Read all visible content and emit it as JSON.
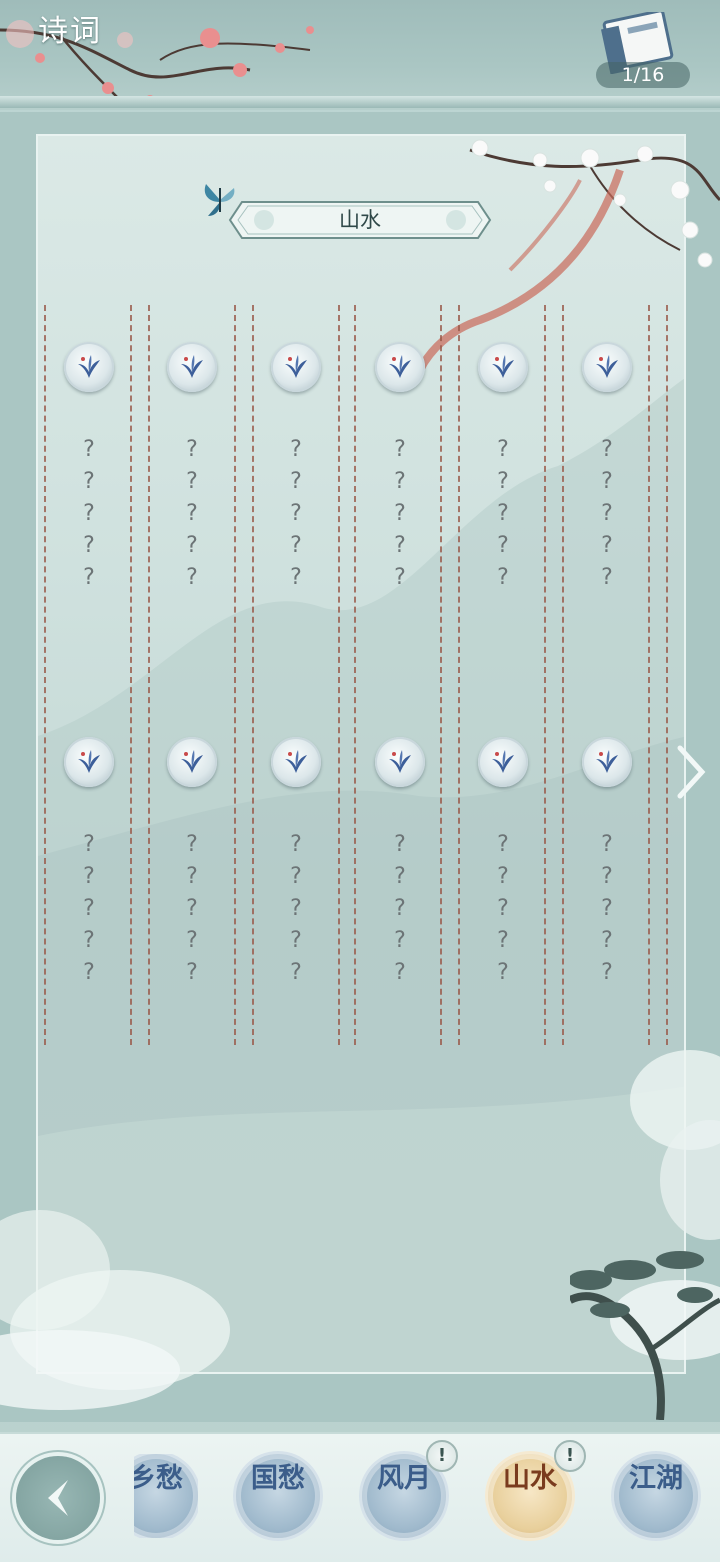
{
  "header": {
    "title": "诗词",
    "page_indicator": "1/16",
    "book_icon": "poetry-book-icon"
  },
  "section": {
    "banner_title": "山水"
  },
  "grid": {
    "rows": [
      {
        "cards": [
          {
            "icon": "orchid-medal-icon",
            "lines": [
              "?",
              "?",
              "?",
              "?",
              "?"
            ]
          },
          {
            "icon": "orchid-medal-icon",
            "lines": [
              "?",
              "?",
              "?",
              "?",
              "?"
            ]
          },
          {
            "icon": "orchid-medal-icon",
            "lines": [
              "?",
              "?",
              "?",
              "?",
              "?"
            ]
          },
          {
            "icon": "orchid-medal-icon",
            "lines": [
              "?",
              "?",
              "?",
              "?",
              "?"
            ]
          },
          {
            "icon": "orchid-medal-icon",
            "lines": [
              "?",
              "?",
              "?",
              "?",
              "?"
            ]
          },
          {
            "icon": "orchid-medal-icon",
            "lines": [
              "?",
              "?",
              "?",
              "?",
              "?"
            ]
          }
        ]
      },
      {
        "cards": [
          {
            "icon": "orchid-medal-icon",
            "lines": [
              "?",
              "?",
              "?",
              "?",
              "?"
            ]
          },
          {
            "icon": "orchid-medal-icon",
            "lines": [
              "?",
              "?",
              "?",
              "?",
              "?"
            ]
          },
          {
            "icon": "orchid-medal-icon",
            "lines": [
              "?",
              "?",
              "?",
              "?",
              "?"
            ]
          },
          {
            "icon": "orchid-medal-icon",
            "lines": [
              "?",
              "?",
              "?",
              "?",
              "?"
            ]
          },
          {
            "icon": "orchid-medal-icon",
            "lines": [
              "?",
              "?",
              "?",
              "?",
              "?"
            ]
          },
          {
            "icon": "orchid-medal-icon",
            "lines": [
              "?",
              "?",
              "?",
              "?",
              "?"
            ]
          }
        ]
      }
    ]
  },
  "navigation": {
    "next_icon": "chevron-right-icon",
    "back_icon": "back-arrow-icon"
  },
  "tabs": [
    {
      "label": "乡愁",
      "alert": ""
    },
    {
      "label": "国愁",
      "alert": ""
    },
    {
      "label": "风月",
      "alert": "!"
    },
    {
      "label": "山水",
      "alert": "!"
    },
    {
      "label": "江湖",
      "alert": ""
    }
  ],
  "colors": {
    "accent": "#e8cf9b",
    "tab_blue": "#9fb9cc",
    "panel": "#cfe1de",
    "string": "#9a5a4a"
  }
}
